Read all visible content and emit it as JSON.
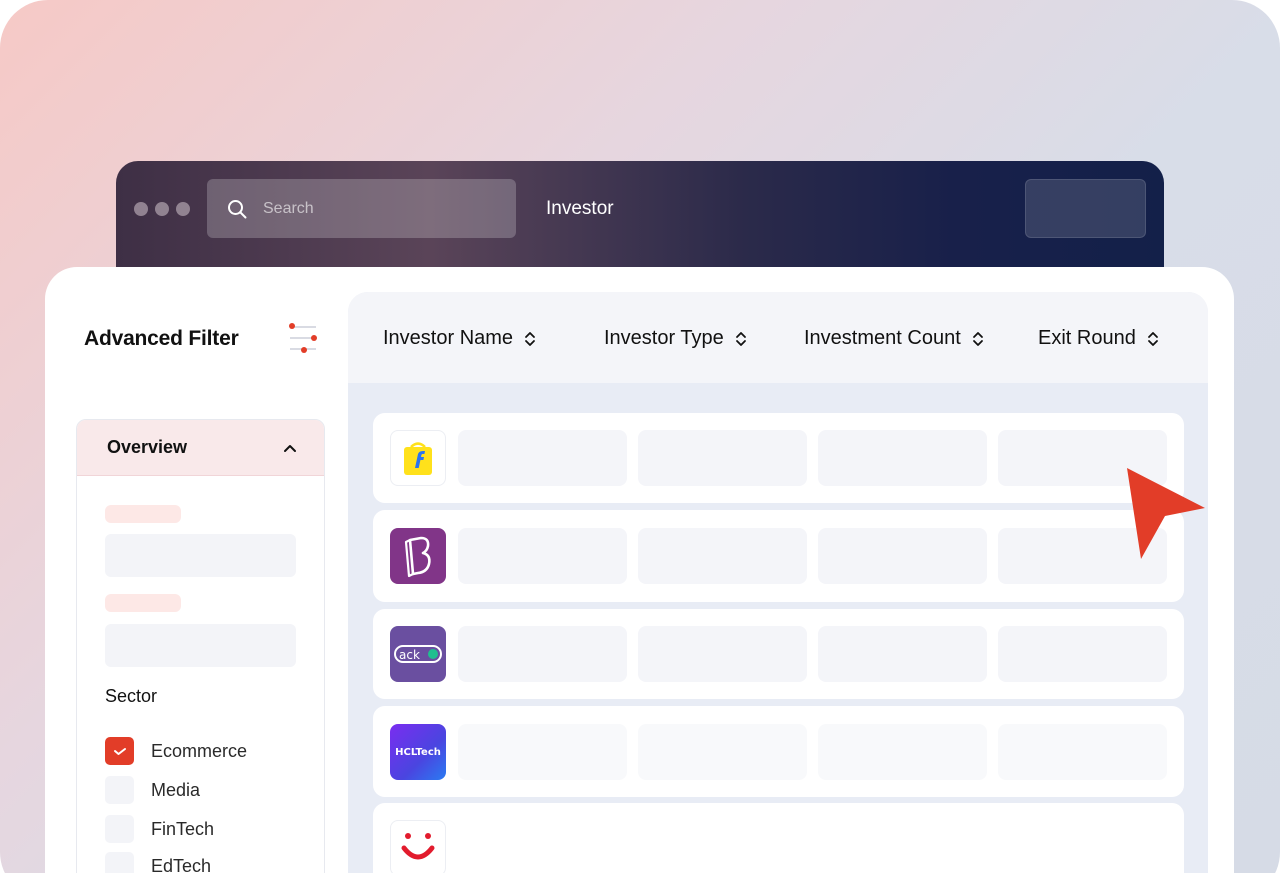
{
  "window": {
    "search_placeholder": "Search",
    "title": "Investor",
    "icons": [
      "search-icon"
    ]
  },
  "sidebar": {
    "title": "Advanced Filter",
    "filter_icon": "sliders-icon",
    "overview": {
      "label": "Overview",
      "expanded": true
    },
    "sector_label": "Sector",
    "sectors": [
      {
        "label": "Ecommerce",
        "checked": true
      },
      {
        "label": "Media",
        "checked": false
      },
      {
        "label": "FinTech",
        "checked": false
      },
      {
        "label": "EdTech",
        "checked": false
      }
    ]
  },
  "table": {
    "columns": [
      "Investor Name",
      "Investor Type",
      "Investment Count",
      "Exit Round"
    ],
    "rows": [
      {
        "logo": "flipkart-logo",
        "logo_color": "#ffe11b"
      },
      {
        "logo": "byjus-logo",
        "logo_color": "#813588"
      },
      {
        "logo": "acko-logo",
        "logo_color": "#6a4fa0"
      },
      {
        "logo": "hcltech-logo",
        "logo_color": "#5b3bd8",
        "logo_text": "HCLTech"
      },
      {
        "logo": "smile-logo",
        "logo_color": "#e21b2d"
      }
    ]
  },
  "colors": {
    "accent": "#e23d28",
    "dark_bar": "#132049"
  }
}
